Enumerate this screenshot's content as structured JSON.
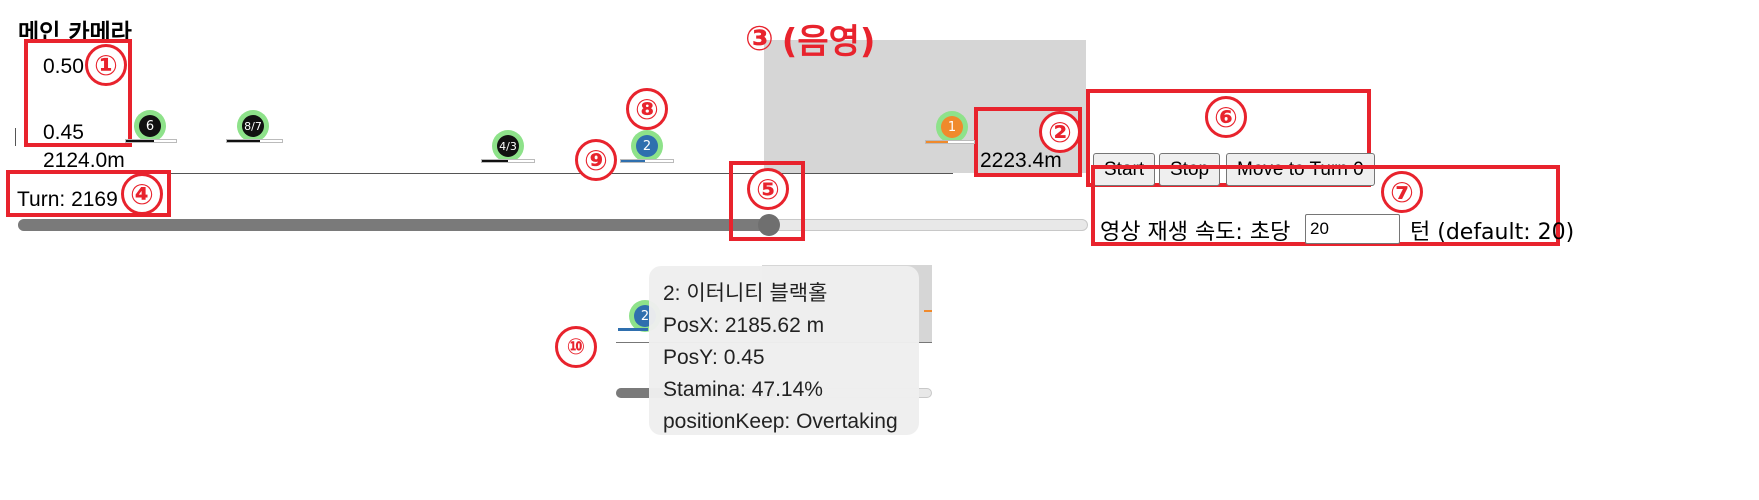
{
  "page": {
    "title": "메인 카메라"
  },
  "annotations": {
    "n1": "①",
    "n2": "②",
    "n3": "③",
    "n3_label": "(음영)",
    "n4": "④",
    "n5": "⑤",
    "n6": "⑥",
    "n7": "⑦",
    "n8": "⑧",
    "n9": "⑨",
    "n10": "⑩"
  },
  "camera": {
    "y_top": "0.50",
    "y_bottom": "0.45",
    "x_start": "2124.0m",
    "x_end": "2223.4m"
  },
  "turn": {
    "label": "Turn: 2169",
    "slider_value": 0.66
  },
  "controls": {
    "start": "Start",
    "stop": "Stop",
    "move_to_turn0": "Move to Turn 0",
    "speed_prefix": "영상 재생 속도: 초당",
    "speed_value": "20",
    "speed_suffix": "턴 (default: 20)"
  },
  "runners": [
    {
      "label": "6",
      "color": "#111111",
      "fill": 0.55
    },
    {
      "label": "8/7",
      "color": "#111111",
      "fill": 0.6
    },
    {
      "label": "4/3",
      "color": "#111111",
      "fill": 0.5
    },
    {
      "label": "2",
      "color": "#2f6fae",
      "fill": 0.47
    },
    {
      "label": "1",
      "color": "#f08a2c",
      "fill": 0.45
    }
  ],
  "mini": {
    "runner_label": "2"
  },
  "tooltip": {
    "line1": "2: 이터니티 블랙홀",
    "line2": "PosX: 2185.62 m",
    "line3": "PosY: 0.45",
    "line4": "Stamina: 47.14%",
    "line5": "positionKeep: Overtaking"
  },
  "colors": {
    "accent_red": "#e8232d",
    "highlight_green": "#8ee28a",
    "shade_gray": "#d6d6d6"
  }
}
